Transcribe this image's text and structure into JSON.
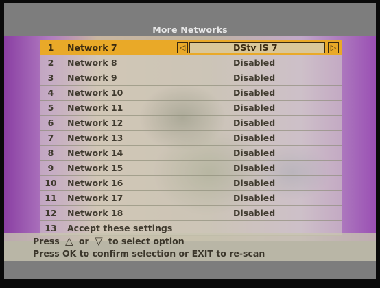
{
  "title": "More Networks",
  "rows": [
    {
      "num": "1",
      "name": "Network 7",
      "value": "DStv IS 7"
    },
    {
      "num": "2",
      "name": "Network 8",
      "value": "Disabled"
    },
    {
      "num": "3",
      "name": "Network 9",
      "value": "Disabled"
    },
    {
      "num": "4",
      "name": "Network 10",
      "value": "Disabled"
    },
    {
      "num": "5",
      "name": "Network 11",
      "value": "Disabled"
    },
    {
      "num": "6",
      "name": "Network 12",
      "value": "Disabled"
    },
    {
      "num": "7",
      "name": "Network 13",
      "value": "Disabled"
    },
    {
      "num": "8",
      "name": "Network 14",
      "value": "Disabled"
    },
    {
      "num": "9",
      "name": "Network 15",
      "value": "Disabled"
    },
    {
      "num": "10",
      "name": "Network 16",
      "value": "Disabled"
    },
    {
      "num": "11",
      "name": "Network 17",
      "value": "Disabled"
    },
    {
      "num": "12",
      "name": "Network 18",
      "value": "Disabled"
    },
    {
      "num": "13",
      "name": "Accept these settings",
      "value": ""
    }
  ],
  "footer": {
    "press": "Press",
    "or": "or",
    "select_option": "to select option",
    "confirm": "Press OK to confirm selection or EXIT to re-scan"
  },
  "selected_row_color": "#e9a928",
  "icons": {
    "left": "left-triangle",
    "right": "right-triangle",
    "up": "up-triangle",
    "down": "down-triangle"
  }
}
